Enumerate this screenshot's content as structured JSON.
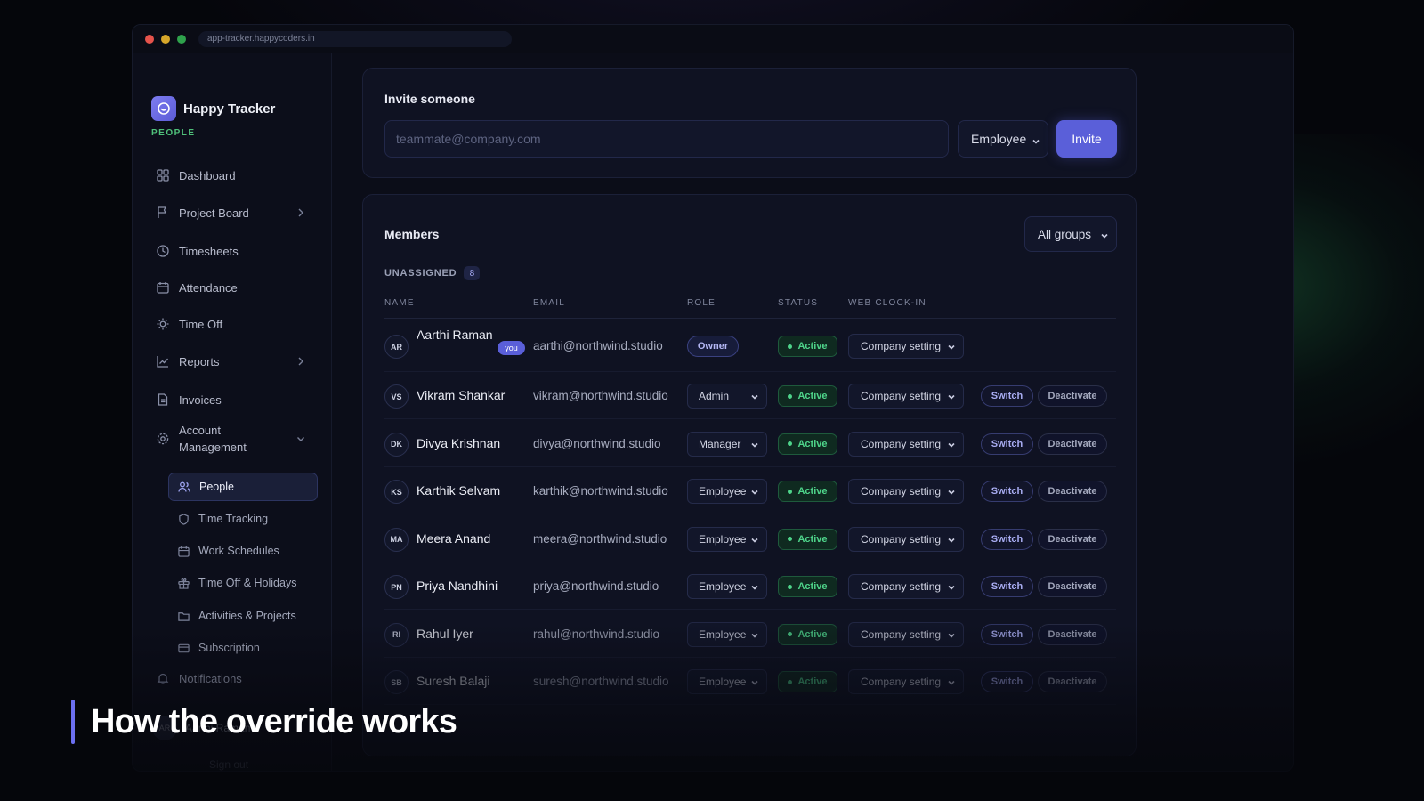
{
  "browser": {
    "url": "app-tracker.happycoders.in"
  },
  "brand": {
    "name": "Happy Tracker",
    "section": "PEOPLE",
    "logo_icon": "smile-clock-icon",
    "accent": "#5a5fd9",
    "success": "#4ed48a"
  },
  "sidebar": {
    "items": [
      {
        "label": "Dashboard",
        "icon": "grid-icon"
      },
      {
        "label": "Project Board",
        "icon": "flag-icon",
        "chevron": "right"
      },
      {
        "label": "Timesheets",
        "icon": "clock-icon"
      },
      {
        "label": "Attendance",
        "icon": "calendar-icon"
      },
      {
        "label": "Time Off",
        "icon": "sun-icon"
      },
      {
        "label": "Reports",
        "icon": "chart-icon",
        "chevron": "right"
      },
      {
        "label": "Invoices",
        "icon": "document-icon"
      },
      {
        "label": "Account Management",
        "icon": "gear-icon",
        "chevron": "down"
      }
    ],
    "sub_items": [
      {
        "label": "People",
        "icon": "people-icon",
        "active": true
      },
      {
        "label": "Time Tracking",
        "icon": "shield-icon"
      },
      {
        "label": "Work Schedules",
        "icon": "calendar-icon"
      },
      {
        "label": "Time Off & Holidays",
        "icon": "gift-icon"
      },
      {
        "label": "Activities & Projects",
        "icon": "folder-icon"
      },
      {
        "label": "Subscription",
        "icon": "card-icon"
      }
    ],
    "notifications": "Notifications",
    "user": {
      "initials": "AR",
      "name": "Aarthi Raman"
    },
    "sign_out": "Sign out"
  },
  "invite": {
    "title": "Invite someone",
    "email_placeholder": "teammate@company.com",
    "role_value": "Employee",
    "button": "Invite"
  },
  "members": {
    "title": "Members",
    "group_filter": "All groups",
    "group_label": "UNASSIGNED",
    "group_count": "8",
    "columns": [
      "NAME",
      "EMAIL",
      "ROLE",
      "STATUS",
      "WEB CLOCK-IN"
    ],
    "you_label": "you",
    "switch_label": "Switch",
    "deactivate_label": "Deactivate",
    "rows": [
      {
        "initials": "AR",
        "name": "Aarthi Raman",
        "email": "aarthi@northwind.studio",
        "role": "Owner",
        "status": "Active",
        "clock_in": "Company setting",
        "is_you": true
      },
      {
        "initials": "VS",
        "name": "Vikram Shankar",
        "email": "vikram@northwind.studio",
        "role": "Admin",
        "status": "Active",
        "clock_in": "Company setting"
      },
      {
        "initials": "DK",
        "name": "Divya Krishnan",
        "email": "divya@northwind.studio",
        "role": "Manager",
        "status": "Active",
        "clock_in": "Company setting"
      },
      {
        "initials": "KS",
        "name": "Karthik Selvam",
        "email": "karthik@northwind.studio",
        "role": "Employee",
        "status": "Active",
        "clock_in": "Company setting"
      },
      {
        "initials": "MA",
        "name": "Meera Anand",
        "email": "meera@northwind.studio",
        "role": "Employee",
        "status": "Active",
        "clock_in": "Company setting"
      },
      {
        "initials": "PN",
        "name": "Priya Nandhini",
        "email": "priya@northwind.studio",
        "role": "Employee",
        "status": "Active",
        "clock_in": "Company setting"
      },
      {
        "initials": "RI",
        "name": "Rahul Iyer",
        "email": "rahul@northwind.studio",
        "role": "Employee",
        "status": "Active",
        "clock_in": "Company setting"
      },
      {
        "initials": "SB",
        "name": "Suresh Balaji",
        "email": "suresh@northwind.studio",
        "role": "Employee",
        "status": "Active",
        "clock_in": "Company setting"
      }
    ]
  },
  "caption": "How the override works"
}
